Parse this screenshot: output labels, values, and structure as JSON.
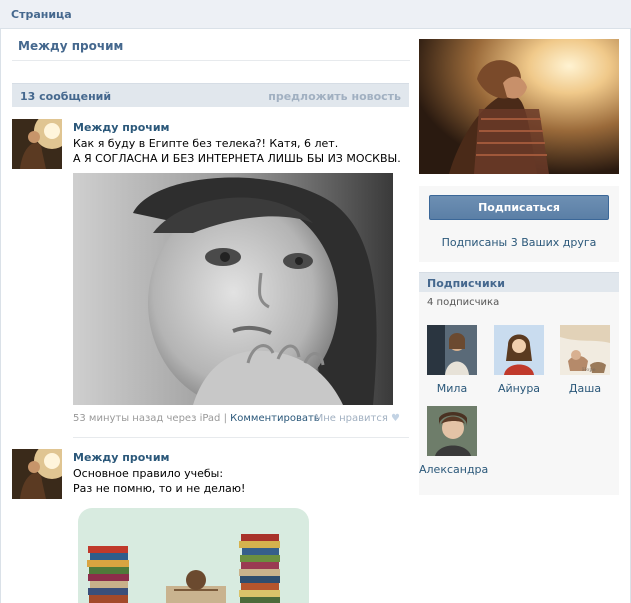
{
  "topbar": {
    "title": "Страница"
  },
  "page": {
    "title": "Между прочим"
  },
  "wall": {
    "count_label": "13 сообщений",
    "suggest_label": "предложить новость"
  },
  "posts": [
    {
      "author": "Между прочим",
      "lines": [
        "Как я буду в Египте без телека?! Катя, 6 лет.",
        "А Я СОГЛАСНА И БЕЗ ИНТЕРНЕТА ЛИШЬ БЫ ИЗ МОСКВЫ."
      ],
      "meta_time": "53 минуты назад через iPad",
      "meta_sep": "|",
      "comment_label": "Комментировать",
      "like_label": "Мне нравится"
    },
    {
      "author": "Между прочим",
      "lines": [
        "Основное правило учебы:",
        "Раз не помню, то и не делаю!"
      ]
    }
  ],
  "sidebar": {
    "subscribe_label": "Подписаться",
    "friends_label": "Подписаны 3 Ваших друга",
    "subscribers_title": "Подписчики",
    "subscribers_count": "4 подписчика",
    "subscribers": [
      {
        "name": "Мила"
      },
      {
        "name": "Айнура"
      },
      {
        "name": "Даша"
      },
      {
        "name": "Александра"
      }
    ]
  }
}
